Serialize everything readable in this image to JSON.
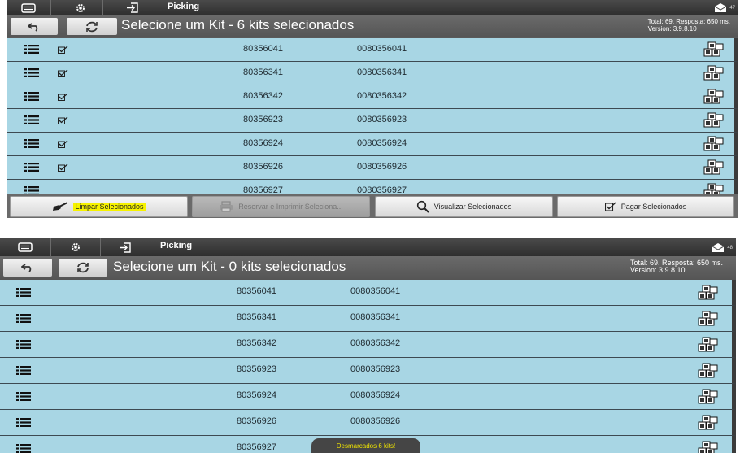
{
  "screens": [
    {
      "topbar": {
        "title": "Picking",
        "right_badge": "47"
      },
      "header": {
        "title": "Selecione um Kit - 6 kits selecionados",
        "info_line1": "Total: 69. Resposta: 650 ms.",
        "info_line2": "Version: 3.9.8.10"
      },
      "rows": [
        {
          "code": "80356041",
          "barcode": "0080356041",
          "checked": true
        },
        {
          "code": "80356341",
          "barcode": "0080356341",
          "checked": true
        },
        {
          "code": "80356342",
          "barcode": "0080356342",
          "checked": true
        },
        {
          "code": "80356923",
          "barcode": "0080356923",
          "checked": true
        },
        {
          "code": "80356924",
          "barcode": "0080356924",
          "checked": true
        },
        {
          "code": "80356926",
          "barcode": "0080356926",
          "checked": true
        },
        {
          "code": "80356927",
          "barcode": "0080356927",
          "checked": true
        }
      ],
      "bottom_buttons": {
        "clear": "Limpar Selecionados",
        "reserve": "Reservar e Imprimir Seleciona...",
        "view": "Visualizar Selecionados",
        "pay": "Pagar Selecionados"
      }
    },
    {
      "topbar": {
        "title": "Picking",
        "right_badge": "48"
      },
      "header": {
        "title": "Selecione um Kit - 0 kits selecionados",
        "info_line1": "Total: 69. Resposta: 650 ms.",
        "info_line2": "Version: 3.9.8.10"
      },
      "rows": [
        {
          "code": "80356041",
          "barcode": "0080356041",
          "checked": false
        },
        {
          "code": "80356341",
          "barcode": "0080356341",
          "checked": false
        },
        {
          "code": "80356342",
          "barcode": "0080356342",
          "checked": false
        },
        {
          "code": "80356923",
          "barcode": "0080356923",
          "checked": false
        },
        {
          "code": "80356924",
          "barcode": "0080356924",
          "checked": false
        },
        {
          "code": "80356926",
          "barcode": "0080356926",
          "checked": false
        },
        {
          "code": "80356927",
          "barcode": "0080356927",
          "checked": false
        }
      ],
      "toast": "Desmarcados 6 kits!"
    }
  ],
  "icons": {
    "menu": "menu-icon",
    "settings": "gear-icon",
    "logout": "exit-icon",
    "back": "undo-icon",
    "refresh": "refresh-icon",
    "list": "list-icon",
    "check": "checkbox-icon",
    "boxes": "boxes-icon",
    "broom": "broom-icon",
    "printer": "printer-icon",
    "search": "search-icon",
    "pay": "check-square-icon"
  }
}
